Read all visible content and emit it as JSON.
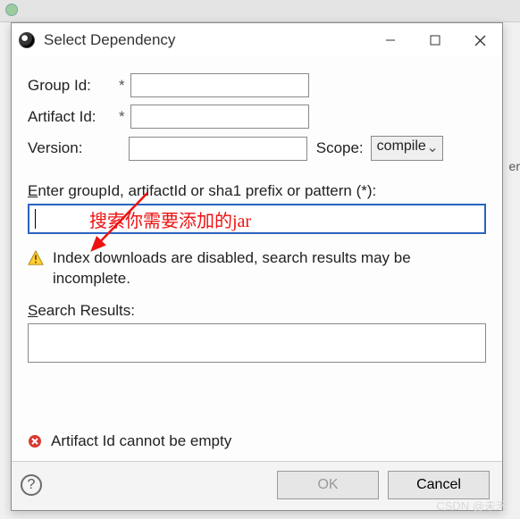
{
  "titlebar": {
    "title": "Select Dependency"
  },
  "form": {
    "groupId": {
      "label": "Group Id:",
      "required": "*",
      "value": ""
    },
    "artifactId": {
      "label": "Artifact Id:",
      "required": "*",
      "value": ""
    },
    "version": {
      "label": "Version:",
      "value": ""
    },
    "scope": {
      "label": "Scope:",
      "selected": "compile"
    }
  },
  "search": {
    "prompt_pre": "E",
    "prompt_rest": "nter groupId, artifactId or sha1 prefix or pattern (*):",
    "value": ""
  },
  "annotation": "搜索你需要添加的jar",
  "warning": "Index downloads are disabled, search results may be incomplete.",
  "resultsLabel_pre": "S",
  "resultsLabel_rest": "earch Results:",
  "error": "Artifact Id cannot be empty",
  "buttons": {
    "ok": "OK",
    "cancel": "Cancel"
  },
  "watermark": "CSDN @未禾",
  "edge_hint": "er"
}
